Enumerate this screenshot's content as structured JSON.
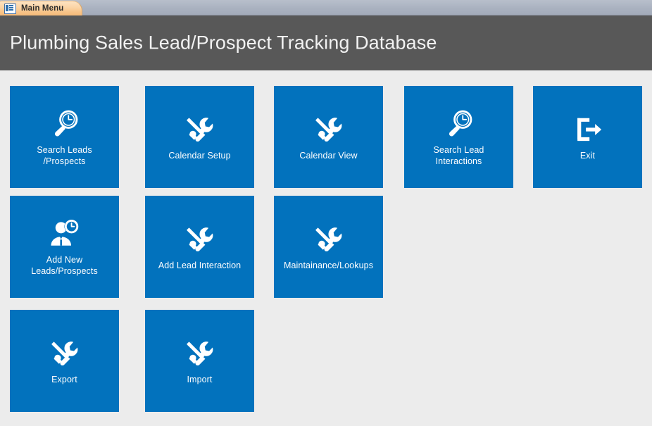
{
  "window": {
    "tab": {
      "label": "Main Menu",
      "icon": "form-grid-icon"
    }
  },
  "header": {
    "title": "Plumbing Sales Lead/Prospect Tracking Database",
    "background": "#585858",
    "text_color": "#f2f2f2"
  },
  "theme": {
    "tile_color": "#0272bd",
    "body_background": "#ececec",
    "tile_text_color": "#ffffff"
  },
  "menu": {
    "tiles": [
      {
        "id": "search-leads-prospects",
        "label": "Search Leads\n/Prospects",
        "icon": "magnifier-clock-icon",
        "col": 0,
        "row": 0
      },
      {
        "id": "calendar-setup",
        "label": "Calendar Setup",
        "icon": "tools-icon",
        "col": 1,
        "row": 0
      },
      {
        "id": "calendar-view",
        "label": "Calendar View",
        "icon": "tools-icon",
        "col": 2,
        "row": 0
      },
      {
        "id": "search-lead-interactions",
        "label": "Search Lead\nInteractions",
        "icon": "magnifier-clock-icon",
        "col": 3,
        "row": 0
      },
      {
        "id": "exit",
        "label": "Exit",
        "icon": "exit-door-icon",
        "col": 4,
        "row": 0
      },
      {
        "id": "add-new-leads-prospects",
        "label": "Add New\nLeads/Prospects",
        "icon": "person-clock-icon",
        "col": 0,
        "row": 1
      },
      {
        "id": "add-lead-interaction",
        "label": "Add Lead Interaction",
        "icon": "tools-icon",
        "col": 1,
        "row": 1
      },
      {
        "id": "maintainance-lookups",
        "label": "Maintainance/Lookups",
        "icon": "tools-icon",
        "col": 2,
        "row": 1
      },
      {
        "id": "export",
        "label": "Export",
        "icon": "tools-icon",
        "col": 0,
        "row": 2
      },
      {
        "id": "import",
        "label": "Import",
        "icon": "tools-icon",
        "col": 1,
        "row": 2
      }
    ]
  }
}
